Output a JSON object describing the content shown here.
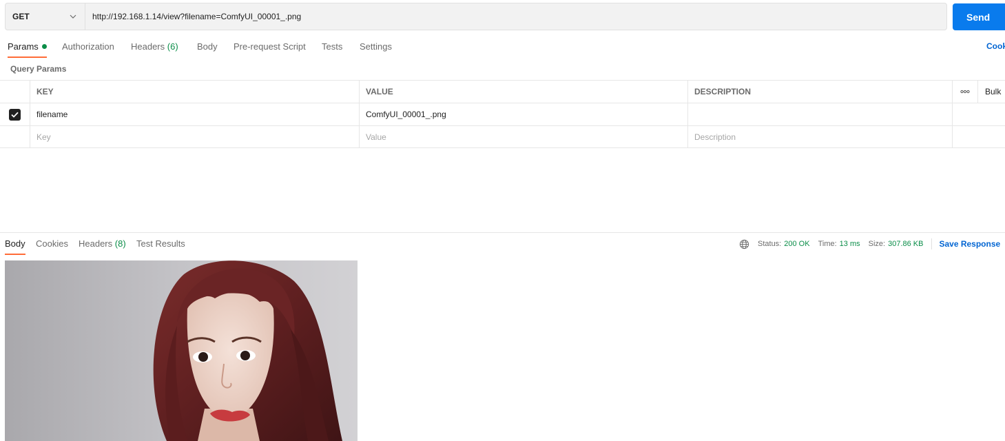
{
  "request": {
    "method": "GET",
    "url": "http://192.168.1.14/view?filename=ComfyUI_00001_.png",
    "send_label": "Send"
  },
  "request_tabs": [
    {
      "label": "Params",
      "active": true,
      "dot": true
    },
    {
      "label": "Authorization"
    },
    {
      "label": "Headers",
      "count": "(6)"
    },
    {
      "label": "Body"
    },
    {
      "label": "Pre-request Script"
    },
    {
      "label": "Tests"
    },
    {
      "label": "Settings"
    }
  ],
  "cookies_link": "Cook",
  "query_params": {
    "title": "Query Params",
    "columns": [
      "KEY",
      "VALUE",
      "DESCRIPTION"
    ],
    "bulk_label": "Bulk",
    "rows": [
      {
        "checked": true,
        "key": "filename",
        "value": "ComfyUI_00001_.png",
        "description": ""
      }
    ],
    "placeholders": {
      "key": "Key",
      "value": "Value",
      "description": "Description"
    }
  },
  "response_tabs": [
    {
      "label": "Body",
      "active": true
    },
    {
      "label": "Cookies"
    },
    {
      "label": "Headers",
      "count": "(8)"
    },
    {
      "label": "Test Results"
    }
  ],
  "response_status": {
    "status_label": "Status:",
    "status_value": "200 OK",
    "time_label": "Time:",
    "time_value": "13 ms",
    "size_label": "Size:",
    "size_value": "307.86 KB",
    "save_label": "Save Response"
  },
  "colors": {
    "accent": "#ff6c37",
    "send": "#097bed",
    "success": "#0a8d48",
    "link": "#0265d2"
  }
}
